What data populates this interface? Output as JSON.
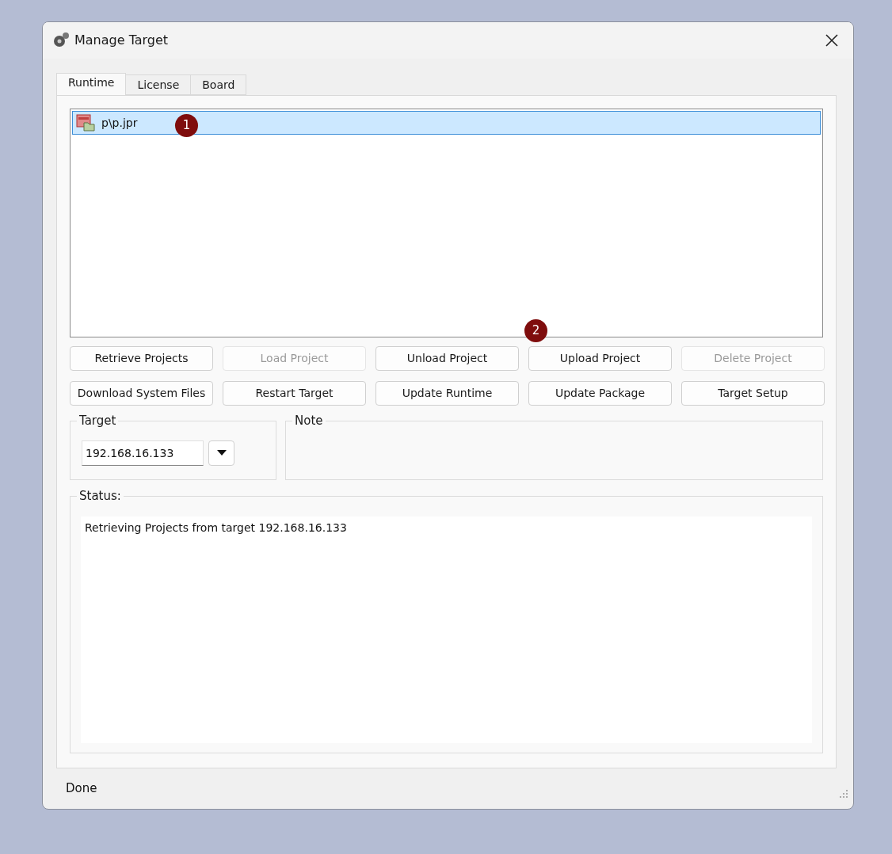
{
  "window": {
    "title": "Manage Target"
  },
  "tabs": [
    {
      "label": "Runtime",
      "selected": true
    },
    {
      "label": "License",
      "selected": false
    },
    {
      "label": "Board",
      "selected": false
    }
  ],
  "projects": [
    {
      "name": "p\\p.jpr",
      "selected": true
    }
  ],
  "buttons": [
    {
      "label": "Retrieve Projects",
      "disabled": false
    },
    {
      "label": "Load Project",
      "disabled": true
    },
    {
      "label": "Unload Project",
      "disabled": false
    },
    {
      "label": "Upload Project",
      "disabled": false
    },
    {
      "label": "Delete Project",
      "disabled": true
    },
    {
      "label": "Download System Files",
      "disabled": false
    },
    {
      "label": "Restart Target",
      "disabled": false
    },
    {
      "label": "Update Runtime",
      "disabled": false
    },
    {
      "label": "Update Package",
      "disabled": false
    },
    {
      "label": "Target Setup",
      "disabled": false
    }
  ],
  "target": {
    "title": "Target",
    "value": "192.168.16.133"
  },
  "note": {
    "title": "Note"
  },
  "status": {
    "title": "Status:",
    "text": "Retrieving Projects from target 192.168.16.133"
  },
  "callouts": [
    "1",
    "2"
  ],
  "status_bar": "Done"
}
